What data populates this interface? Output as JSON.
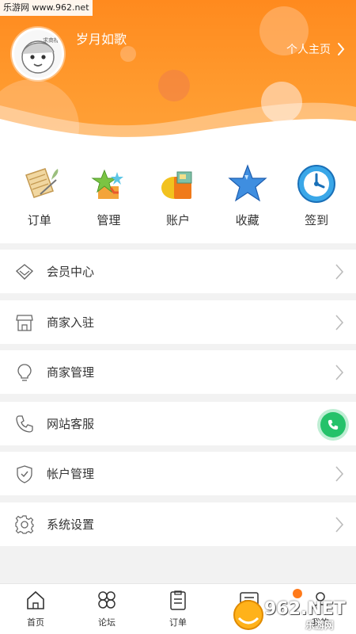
{
  "watermark": {
    "site": "乐游网 www.962.net",
    "brand": "962.NET",
    "brand_sub": "乐游网"
  },
  "header": {
    "avatar_tag": "求商标",
    "username": "岁月如歌",
    "profile_link": "个人主页"
  },
  "quick_actions": [
    {
      "label": "订单",
      "icon": "scroll-quill-icon"
    },
    {
      "label": "管理",
      "icon": "stars-gift-icon"
    },
    {
      "label": "账户",
      "icon": "wallet-book-icon"
    },
    {
      "label": "收藏",
      "icon": "blue-star-icon"
    },
    {
      "label": "签到",
      "icon": "clock-signin-icon"
    }
  ],
  "menu": [
    {
      "label": "会员中心",
      "icon": "diamond-icon"
    },
    {
      "label": "商家入驻",
      "icon": "storefront-icon"
    },
    {
      "label": "商家管理",
      "icon": "lightbulb-icon"
    },
    {
      "label": "网站客服",
      "icon": "phone-icon"
    },
    {
      "label": "帐户管理",
      "icon": "shield-check-icon"
    },
    {
      "label": "系统设置",
      "icon": "gear-icon"
    }
  ],
  "tabbar": [
    {
      "label": "首页",
      "icon": "home-icon"
    },
    {
      "label": "论坛",
      "icon": "forum-icon"
    },
    {
      "label": "订单",
      "icon": "order-clipboard-icon"
    },
    {
      "label": "消息",
      "icon": "message-icon"
    },
    {
      "label": "我的",
      "icon": "profile-icon"
    }
  ],
  "colors": {
    "accent": "#ff8a1e",
    "call_green": "#25c26a",
    "badge": "#ff7a1a"
  }
}
